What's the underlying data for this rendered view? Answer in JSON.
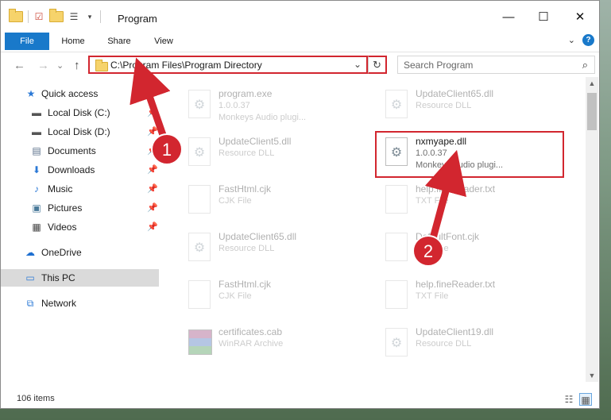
{
  "titlebar": {
    "title": "Program",
    "qat_icons": [
      "folder-icon",
      "checklist-icon",
      "folder-icon",
      "properties-icon",
      "dropdown-arrow-icon"
    ],
    "minimize_glyph": "—",
    "maximize_glyph": "☐",
    "close_glyph": "✕"
  },
  "ribbon": {
    "tabs": [
      "File",
      "Home",
      "Share",
      "View"
    ],
    "collapse_glyph": "⌄",
    "help_glyph": "?"
  },
  "address": {
    "back_glyph": "←",
    "forward_glyph": "→",
    "recent_glyph": "⌄",
    "up_glyph": "↑",
    "path": "C:\\Program Files\\Program Directory",
    "dropdown_glyph": "⌄",
    "refresh_glyph": "↻",
    "search_placeholder": "Search Program",
    "search_glyph": "⌕"
  },
  "sidebar": {
    "items": [
      {
        "label": "Quick access",
        "icon": "star-icon",
        "glyph": "★",
        "color": "#2b79d6",
        "pinned": false
      },
      {
        "label": "Local Disk (C:)",
        "icon": "drive-icon",
        "glyph": "▬",
        "color": "#555555",
        "pinned": true
      },
      {
        "label": "Local Disk (D:)",
        "icon": "drive-icon",
        "glyph": "▬",
        "color": "#555555",
        "pinned": true
      },
      {
        "label": "Documents",
        "icon": "documents-icon",
        "glyph": "▤",
        "color": "#5a6f8a",
        "pinned": true
      },
      {
        "label": "Downloads",
        "icon": "download-icon",
        "glyph": "⬇",
        "color": "#2b79d6",
        "pinned": true
      },
      {
        "label": "Music",
        "icon": "music-icon",
        "glyph": "♪",
        "color": "#2b79d6",
        "pinned": true
      },
      {
        "label": "Pictures",
        "icon": "pictures-icon",
        "glyph": "▣",
        "color": "#4a7a9a",
        "pinned": true
      },
      {
        "label": "Videos",
        "icon": "videos-icon",
        "glyph": "▦",
        "color": "#444444",
        "pinned": true
      },
      {
        "label": "OneDrive",
        "icon": "cloud-icon",
        "glyph": "☁",
        "color": "#1e6fd0",
        "pinned": false
      },
      {
        "label": "This PC",
        "icon": "computer-icon",
        "glyph": "▭",
        "color": "#2b79d6",
        "pinned": false
      },
      {
        "label": "Network",
        "icon": "network-icon",
        "glyph": "⧉",
        "color": "#2b79d6",
        "pinned": false
      }
    ],
    "pin_glyph": "📌"
  },
  "files": [
    {
      "name": "program.exe",
      "sub1": "1.0.0.37",
      "sub2": "Monkeys Audio plugi...",
      "icon": "exe-icon",
      "faded": true
    },
    {
      "name": "UpdateClient65.dll",
      "sub1": "Resource DLL",
      "sub2": "",
      "icon": "dll-icon",
      "faded": true
    },
    {
      "name": "UpdateClient5.dll",
      "sub1": "Resource DLL",
      "sub2": "",
      "icon": "dll-icon",
      "faded": true
    },
    {
      "name": "nxmyape.dll",
      "sub1": "1.0.0.37",
      "sub2": "Monkeys Audio plugi...",
      "icon": "dll-icon",
      "faded": false
    },
    {
      "name": "FastHtml.cjk",
      "sub1": "CJK File",
      "sub2": "",
      "icon": "file-icon",
      "faded": true
    },
    {
      "name": "help.fineReader.txt",
      "sub1": "TXT File",
      "sub2": "",
      "icon": "file-icon",
      "faded": true
    },
    {
      "name": "UpdateClient65.dll",
      "sub1": "Resource DLL",
      "sub2": "",
      "icon": "dll-icon",
      "faded": true
    },
    {
      "name": "DefaultFont.cjk",
      "sub1": "CJK File",
      "sub2": "",
      "icon": "file-icon",
      "faded": true
    },
    {
      "name": "FastHtml.cjk",
      "sub1": "CJK File",
      "sub2": "",
      "icon": "file-icon",
      "faded": true
    },
    {
      "name": "help.fineReader.txt",
      "sub1": "TXT File",
      "sub2": "",
      "icon": "file-icon",
      "faded": true
    },
    {
      "name": "certificates.cab",
      "sub1": "WinRAR Archive",
      "sub2": "",
      "icon": "archive-icon",
      "faded": true
    },
    {
      "name": "UpdateClient19.dll",
      "sub1": "Resource DLL",
      "sub2": "",
      "icon": "dll-icon",
      "faded": true
    }
  ],
  "status": {
    "item_count": "106 items",
    "details_view_glyph": "☷",
    "tiles_view_glyph": "▦"
  },
  "annotations": {
    "badge_1": "1",
    "badge_2": "2",
    "accent_color": "#d2262f"
  }
}
